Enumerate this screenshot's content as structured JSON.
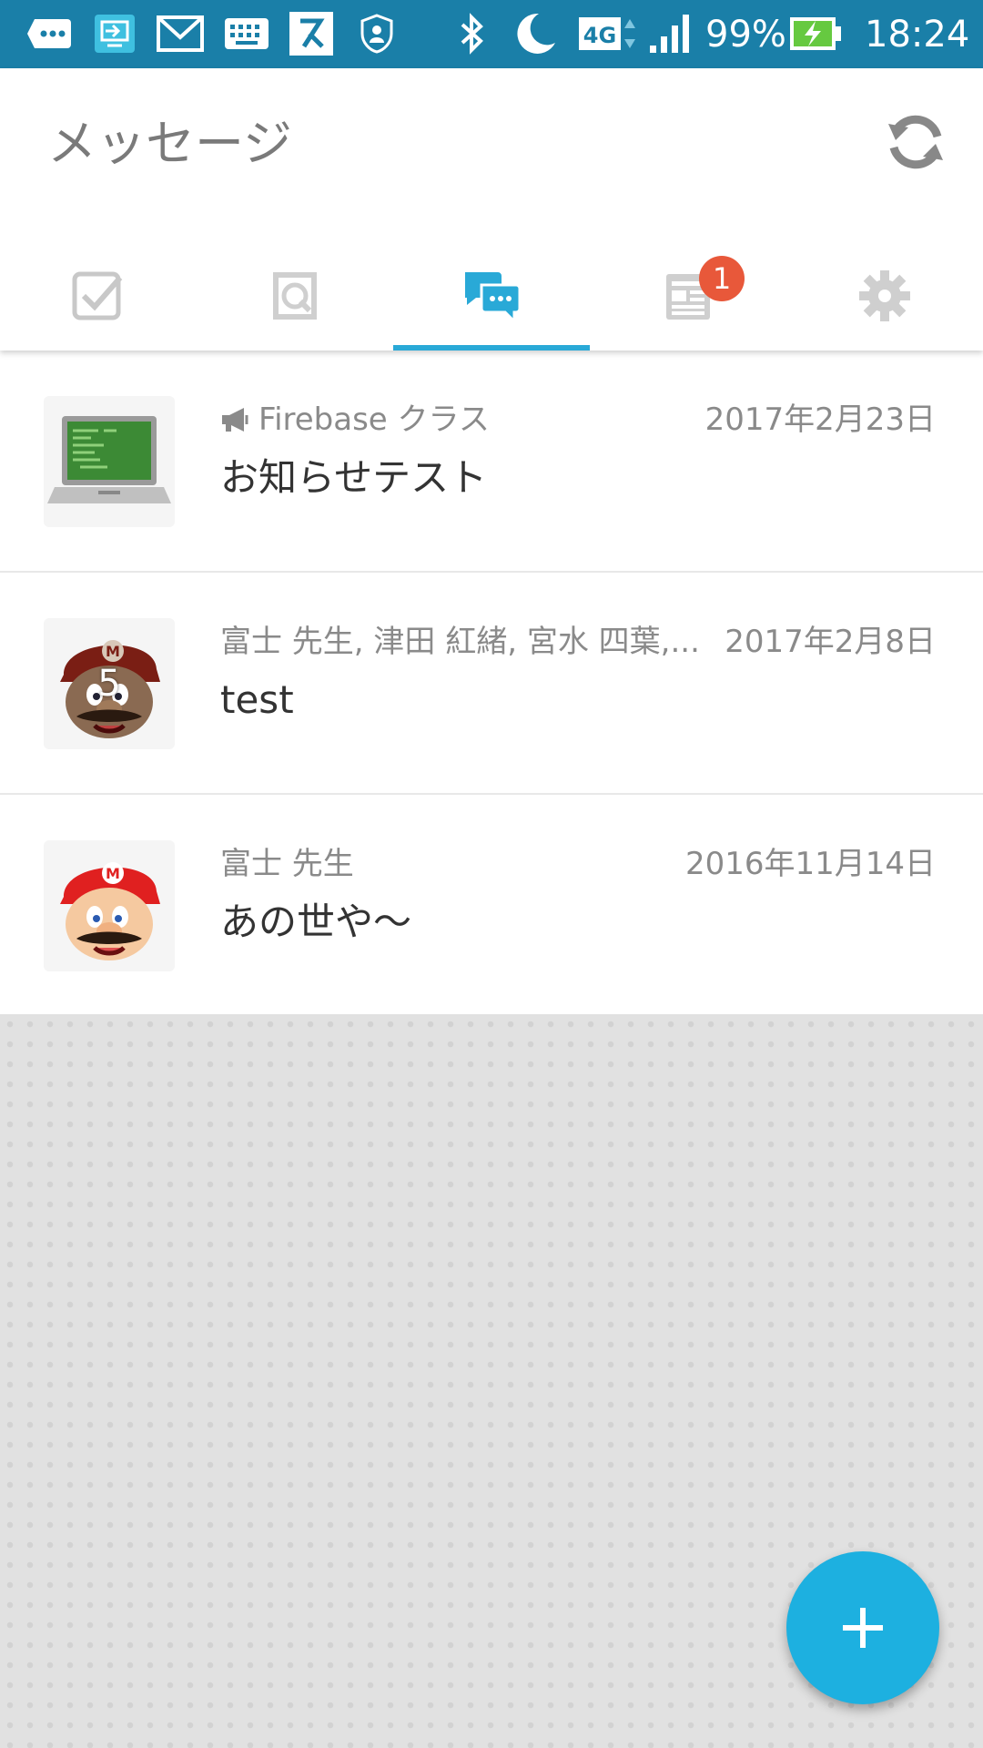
{
  "status_bar": {
    "network_type": "4G",
    "battery_percent": "99%",
    "time": "18:24",
    "icons": [
      "more-icon",
      "screen-cast-icon",
      "gmail-icon",
      "keyboard-icon",
      "app-icon",
      "security-icon",
      "bluetooth-icon",
      "do-not-disturb-icon",
      "network-4g-icon",
      "signal-icon",
      "battery-charging-icon"
    ]
  },
  "header": {
    "title": "メッセージ",
    "refresh_icon": "refresh-icon"
  },
  "tabs": [
    {
      "icon": "checkbox-icon",
      "selected": false
    },
    {
      "icon": "notebook-icon",
      "selected": false
    },
    {
      "icon": "chat-bubbles-icon",
      "selected": true
    },
    {
      "icon": "news-icon",
      "selected": false,
      "badge": "1"
    },
    {
      "icon": "gear-icon",
      "selected": false
    }
  ],
  "messages": [
    {
      "sender": "Firebase クラス",
      "sender_icon": "megaphone-icon",
      "date": "2017年2月23日",
      "text": "お知らせテスト",
      "avatar": "computer-avatar"
    },
    {
      "sender": "富士 先生, 津田 紅緒, 宮水 四葉,...",
      "date": "2017年2月8日",
      "text": "test",
      "avatar": "mario-avatar-dark",
      "avatar_count": "5"
    },
    {
      "sender": "富士 先生",
      "date": "2016年11月14日",
      "text": "あの世や〜",
      "avatar": "mario-avatar"
    }
  ],
  "fab": {
    "icon": "plus-icon"
  },
  "colors": {
    "status_bar": "#1a7fa8",
    "accent": "#29a9d7",
    "badge": "#e8583a",
    "fab": "#1db0e0"
  }
}
